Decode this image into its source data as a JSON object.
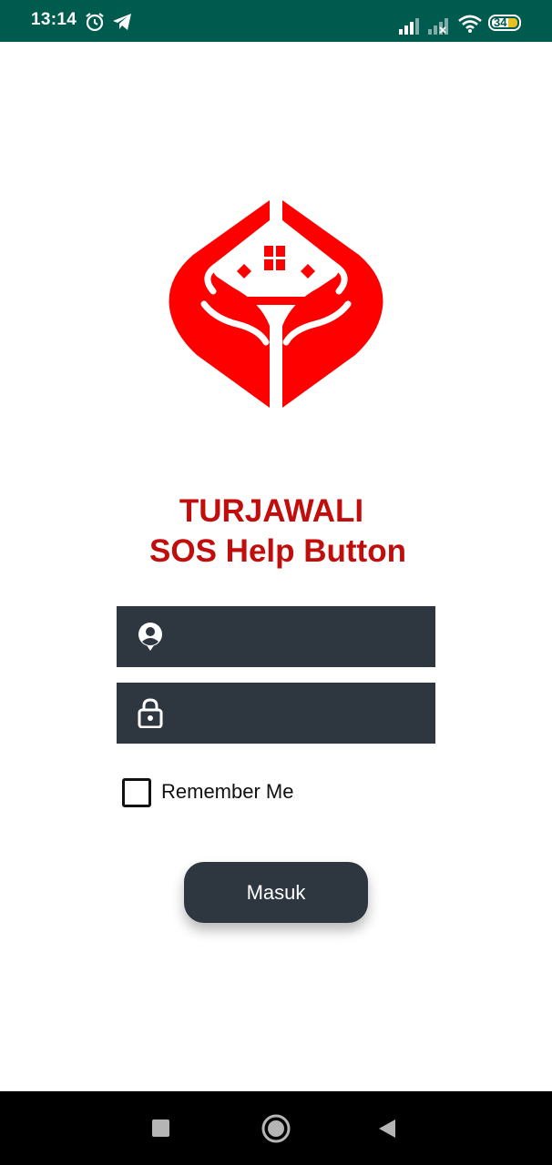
{
  "status_bar": {
    "time": "13:14",
    "battery": "34",
    "icons": [
      "alarm-icon",
      "telegram-icon",
      "signal-icon",
      "signal-no-service-icon",
      "wifi-icon",
      "battery-icon"
    ]
  },
  "app": {
    "logo_icon": "house-in-hands-logo",
    "title_line1": "TURJAWALI",
    "title_line2": "SOS Help Button",
    "brand_color": "#c20d0d"
  },
  "login": {
    "username_value": "",
    "password_value": "",
    "username_icon": "user-icon",
    "password_icon": "lock-icon",
    "remember_label": "Remember Me",
    "remember_checked": false,
    "submit_label": "Masuk"
  },
  "nav": {
    "icons": [
      "recents-square-icon",
      "home-circle-icon",
      "back-triangle-icon"
    ]
  },
  "colors": {
    "status_bar": "#005b4f",
    "field_bg": "#2e3640",
    "button_bg": "#2e3640"
  }
}
